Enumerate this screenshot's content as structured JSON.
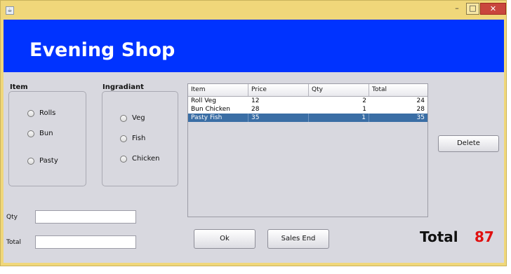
{
  "window": {
    "controls": {
      "minimize": "–",
      "maximize": "□",
      "close": "✕"
    }
  },
  "header": {
    "title": "Evening Shop"
  },
  "item_group": {
    "label": "Item",
    "options": [
      "Rolls",
      "Bun",
      "Pasty"
    ]
  },
  "ingredient_group": {
    "label": "Ingradiant",
    "options": [
      "Veg",
      "Fish",
      "Chicken"
    ]
  },
  "table": {
    "columns": [
      "Item",
      "Price",
      "Qty",
      "Total"
    ],
    "rows": [
      {
        "item": "Roll Veg",
        "price": "12",
        "qty": "2",
        "total": "24",
        "selected": false
      },
      {
        "item": "Bun Chicken",
        "price": "28",
        "qty": "1",
        "total": "28",
        "selected": false
      },
      {
        "item": "Pasty Fish",
        "price": "35",
        "qty": "1",
        "total": "35",
        "selected": true
      }
    ]
  },
  "form": {
    "qty_label": "Qty",
    "qty_value": "",
    "total_label": "Total",
    "total_value": ""
  },
  "buttons": {
    "delete": "Delete",
    "ok": "Ok",
    "sales_end": "Sales End"
  },
  "summary": {
    "total_label": "Total",
    "total_value": "87"
  },
  "colors": {
    "header_bg": "#0033ff",
    "selection": "#3a6ea5",
    "total_value": "#e01010"
  }
}
